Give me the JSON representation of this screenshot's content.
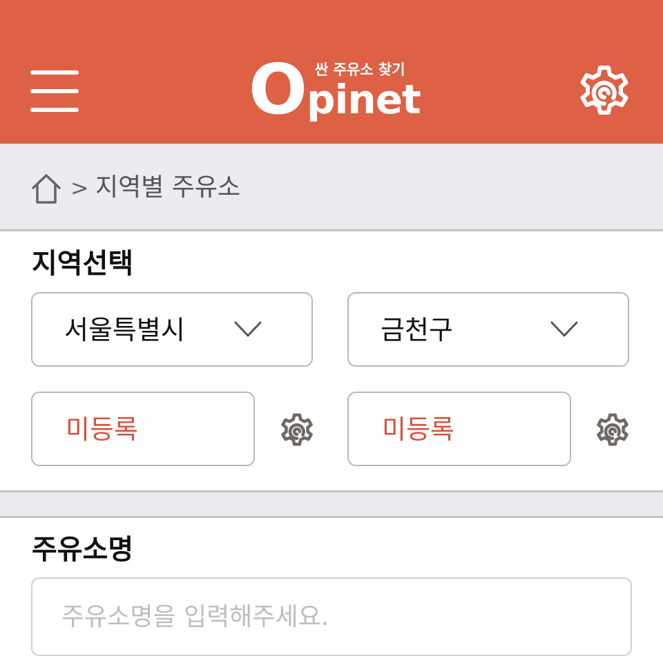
{
  "header": {
    "logo_text": "Opinet",
    "logo_tagline": "싼 주유소 찾기",
    "menu_icon": "hamburger-menu-icon",
    "settings_icon": "gear-icon",
    "background_color": "#de6045"
  },
  "breadcrumb": {
    "home_icon": "home-icon",
    "separator": ">",
    "current": "지역별 주유소"
  },
  "region_section": {
    "title": "지역선택",
    "province": {
      "value": "서울특별시",
      "icon": "chevron-down-icon"
    },
    "district": {
      "value": "금천구",
      "icon": "chevron-down-icon"
    },
    "favorites": [
      {
        "label": "미등록",
        "icon": "gear-icon"
      },
      {
        "label": "미등록",
        "icon": "gear-icon"
      }
    ],
    "accent_color": "#d9503c"
  },
  "station_name_section": {
    "title": "주유소명",
    "input_value": "",
    "placeholder": "주유소명을 입력해주세요."
  }
}
